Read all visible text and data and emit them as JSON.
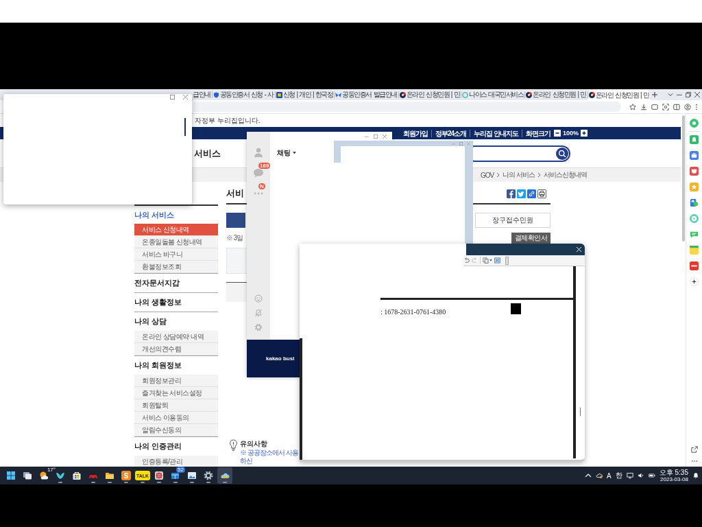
{
  "browser": {
    "tabs": [
      {
        "title": "급안내",
        "kind": "plain",
        "selected": false
      },
      {
        "title": "공동인증서 신청 - 사",
        "kind": "shield",
        "selected": false
      },
      {
        "title": "신청 | 개인 | 한국정",
        "kind": "square",
        "selected": false
      },
      {
        "title": "공동인증서 발급안내",
        "kind": "butterfly",
        "selected": false
      },
      {
        "title": "온라인 신청민원 | 민",
        "kind": "swirl",
        "selected": false
      },
      {
        "title": "나이스 대국민서비스",
        "kind": "ring",
        "selected": false
      },
      {
        "title": "온라인 신청민원 | 민",
        "kind": "swirl",
        "selected": false
      },
      {
        "title": "온라인 신청민원 | 민",
        "kind": "swirl",
        "selected": true
      }
    ]
  },
  "page": {
    "notice": "자정부 누리집입니다.",
    "utility_links": [
      "회원가입",
      "정부24소개",
      "누리집 안내지도"
    ],
    "text_size": {
      "label": "화면크기",
      "value": "100%"
    },
    "nav": [
      "서비스"
    ],
    "breadcrumb": [
      "GOV",
      "나의 서비스",
      "서비스신청내역"
    ],
    "sidebar": [
      {
        "title": "나의 서비스",
        "selected": true,
        "items": [
          {
            "label": "서비스 신청내역",
            "selected": true
          },
          {
            "label": "온종일돌봄 신청내역",
            "selected": false
          },
          {
            "label": "서비스 바구니",
            "selected": false
          },
          {
            "label": "환불정보조회",
            "selected": false
          }
        ]
      },
      {
        "title": "전자문서지갑",
        "selected": false
      },
      {
        "title": "나의 생활정보",
        "selected": false
      },
      {
        "title": "나의 상담",
        "selected": false,
        "items": [
          {
            "label": "온라인 상담예약 내역",
            "selected": false
          },
          {
            "label": "개선의견수렴",
            "selected": false
          }
        ]
      },
      {
        "title": "나의 회원정보",
        "selected": false,
        "items": [
          {
            "label": "회원정보관리",
            "selected": false
          },
          {
            "label": "즐겨찾는 서비스설정",
            "selected": false
          },
          {
            "label": "회원탈퇴",
            "selected": false
          },
          {
            "label": "서비스 이용동의",
            "selected": false
          },
          {
            "label": "알림수신동의",
            "selected": false
          }
        ]
      },
      {
        "title": "나의 인증관리",
        "selected": false,
        "items": [
          {
            "label": "인증등록/관리",
            "selected": false
          }
        ]
      }
    ],
    "heading": "서비",
    "tabs": [
      {
        "selected": true
      },
      {
        "label": "장구접수민원",
        "selected": false
      }
    ],
    "note": "※ 3일",
    "receipt_button": "결제확인서",
    "caution": {
      "title": "유의사항",
      "text": "※ 공공장소에서 사용하신"
    }
  },
  "chat_window": {
    "title": "채팅",
    "rail": [
      {
        "kind": "person"
      },
      {
        "kind": "chat",
        "badge": "169"
      },
      {
        "kind": "more",
        "badge": "N"
      }
    ],
    "banner": "kakao busi"
  },
  "document_viewer": {
    "text": ": 1678-2631-0761-4380"
  },
  "taskbar": {
    "apps": [
      {
        "kind": "start",
        "running": false,
        "active": false
      },
      {
        "kind": "task-view",
        "running": false,
        "active": false
      },
      {
        "kind": "weather",
        "label": "17°",
        "running": false,
        "active": false
      },
      {
        "kind": "bird",
        "running": true,
        "active": false
      },
      {
        "kind": "store",
        "running": false,
        "active": false
      },
      {
        "kind": "car",
        "running": true,
        "active": false
      },
      {
        "kind": "folder",
        "running": true,
        "active": false
      },
      {
        "kind": "letter",
        "label": "S",
        "running": true,
        "active": false
      },
      {
        "kind": "talk",
        "label": "TALK",
        "running": true,
        "active": false
      },
      {
        "kind": "grid",
        "running": true,
        "active": false
      },
      {
        "kind": "windows",
        "badge": "52",
        "running": true,
        "active": false
      },
      {
        "kind": "image",
        "running": true,
        "active": false
      },
      {
        "kind": "gear",
        "running": true,
        "active": false
      },
      {
        "kind": "cloud",
        "running": true,
        "active": true
      }
    ],
    "tray": [
      "A",
      "한"
    ],
    "time": "오후 5:35",
    "date": "2023-03-08"
  }
}
